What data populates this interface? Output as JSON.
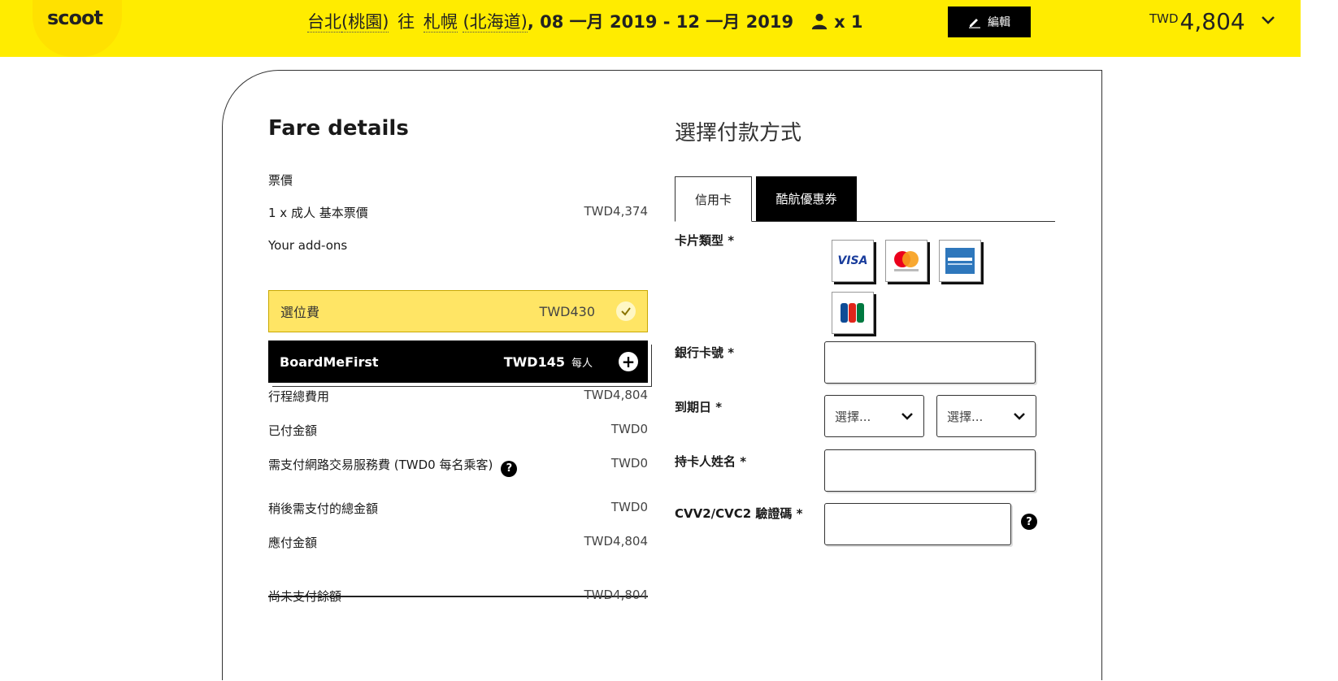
{
  "header": {
    "logo": "scoot",
    "origin": "台北",
    "origin_paren": "(桃園)",
    "connector": "往",
    "destination": "札幌",
    "destination_paren": "(北海道)",
    "date_text": ", 08 一月 2019 - 12 一月 2019",
    "pax_count": "x 1",
    "edit_label": "編輯",
    "total_currency": "TWD",
    "total_amount": "4,804"
  },
  "fare": {
    "title": "Fare details",
    "ticket_label": "票價",
    "base_label": "1 x 成人 基本票價",
    "base_amount": "TWD4,374",
    "addons_label": "Your add-ons",
    "addon_seat_name": "選位費",
    "addon_seat_price": "TWD430",
    "addon_board_name": "BoardMeFirst",
    "addon_board_price": "TWD145",
    "addon_board_per": "每人",
    "trip_total_label": "行程總費用",
    "trip_total_amount": "TWD4,804",
    "paid_label": "已付金額",
    "paid_amount": "TWD0",
    "service_fee_label": "需支付網路交易服務費 (TWD0 每名乘客)",
    "service_fee_amount": "TWD0",
    "later_label": "稍後需支付的總金額",
    "later_amount": "TWD0",
    "due_label": "應付金額",
    "due_amount": "TWD4,804",
    "balance_label": "尚未支付餘額",
    "balance_amount": "TWD4,804"
  },
  "payment": {
    "title": "選擇付款方式",
    "tab_credit": "信用卡",
    "tab_voucher": "酷航優惠券",
    "card_type_label": "卡片類型 *",
    "card_visa": "VISA",
    "card_number_label": "銀行卡號 *",
    "expiry_label": "到期日 *",
    "month_placeholder": "選擇...",
    "year_placeholder": "選擇...",
    "holder_label": "持卡人姓名 *",
    "cvv_label": "CVV2/CVC2 驗證碼 *"
  }
}
